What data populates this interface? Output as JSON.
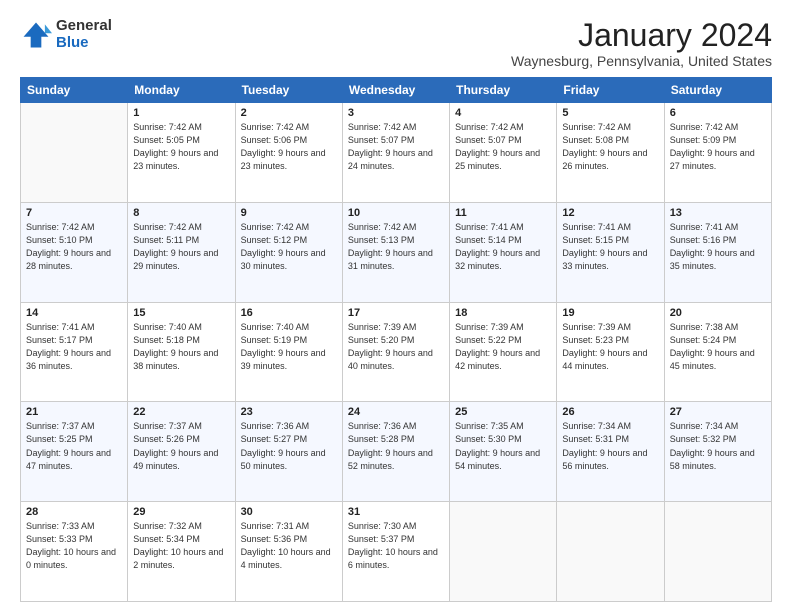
{
  "logo": {
    "general": "General",
    "blue": "Blue"
  },
  "title": "January 2024",
  "location": "Waynesburg, Pennsylvania, United States",
  "weekdays": [
    "Sunday",
    "Monday",
    "Tuesday",
    "Wednesday",
    "Thursday",
    "Friday",
    "Saturday"
  ],
  "weeks": [
    [
      {
        "day": "",
        "sunrise": "",
        "sunset": "",
        "daylight": ""
      },
      {
        "day": "1",
        "sunrise": "Sunrise: 7:42 AM",
        "sunset": "Sunset: 5:05 PM",
        "daylight": "Daylight: 9 hours and 23 minutes."
      },
      {
        "day": "2",
        "sunrise": "Sunrise: 7:42 AM",
        "sunset": "Sunset: 5:06 PM",
        "daylight": "Daylight: 9 hours and 23 minutes."
      },
      {
        "day": "3",
        "sunrise": "Sunrise: 7:42 AM",
        "sunset": "Sunset: 5:07 PM",
        "daylight": "Daylight: 9 hours and 24 minutes."
      },
      {
        "day": "4",
        "sunrise": "Sunrise: 7:42 AM",
        "sunset": "Sunset: 5:07 PM",
        "daylight": "Daylight: 9 hours and 25 minutes."
      },
      {
        "day": "5",
        "sunrise": "Sunrise: 7:42 AM",
        "sunset": "Sunset: 5:08 PM",
        "daylight": "Daylight: 9 hours and 26 minutes."
      },
      {
        "day": "6",
        "sunrise": "Sunrise: 7:42 AM",
        "sunset": "Sunset: 5:09 PM",
        "daylight": "Daylight: 9 hours and 27 minutes."
      }
    ],
    [
      {
        "day": "7",
        "sunrise": "Sunrise: 7:42 AM",
        "sunset": "Sunset: 5:10 PM",
        "daylight": "Daylight: 9 hours and 28 minutes."
      },
      {
        "day": "8",
        "sunrise": "Sunrise: 7:42 AM",
        "sunset": "Sunset: 5:11 PM",
        "daylight": "Daylight: 9 hours and 29 minutes."
      },
      {
        "day": "9",
        "sunrise": "Sunrise: 7:42 AM",
        "sunset": "Sunset: 5:12 PM",
        "daylight": "Daylight: 9 hours and 30 minutes."
      },
      {
        "day": "10",
        "sunrise": "Sunrise: 7:42 AM",
        "sunset": "Sunset: 5:13 PM",
        "daylight": "Daylight: 9 hours and 31 minutes."
      },
      {
        "day": "11",
        "sunrise": "Sunrise: 7:41 AM",
        "sunset": "Sunset: 5:14 PM",
        "daylight": "Daylight: 9 hours and 32 minutes."
      },
      {
        "day": "12",
        "sunrise": "Sunrise: 7:41 AM",
        "sunset": "Sunset: 5:15 PM",
        "daylight": "Daylight: 9 hours and 33 minutes."
      },
      {
        "day": "13",
        "sunrise": "Sunrise: 7:41 AM",
        "sunset": "Sunset: 5:16 PM",
        "daylight": "Daylight: 9 hours and 35 minutes."
      }
    ],
    [
      {
        "day": "14",
        "sunrise": "Sunrise: 7:41 AM",
        "sunset": "Sunset: 5:17 PM",
        "daylight": "Daylight: 9 hours and 36 minutes."
      },
      {
        "day": "15",
        "sunrise": "Sunrise: 7:40 AM",
        "sunset": "Sunset: 5:18 PM",
        "daylight": "Daylight: 9 hours and 38 minutes."
      },
      {
        "day": "16",
        "sunrise": "Sunrise: 7:40 AM",
        "sunset": "Sunset: 5:19 PM",
        "daylight": "Daylight: 9 hours and 39 minutes."
      },
      {
        "day": "17",
        "sunrise": "Sunrise: 7:39 AM",
        "sunset": "Sunset: 5:20 PM",
        "daylight": "Daylight: 9 hours and 40 minutes."
      },
      {
        "day": "18",
        "sunrise": "Sunrise: 7:39 AM",
        "sunset": "Sunset: 5:22 PM",
        "daylight": "Daylight: 9 hours and 42 minutes."
      },
      {
        "day": "19",
        "sunrise": "Sunrise: 7:39 AM",
        "sunset": "Sunset: 5:23 PM",
        "daylight": "Daylight: 9 hours and 44 minutes."
      },
      {
        "day": "20",
        "sunrise": "Sunrise: 7:38 AM",
        "sunset": "Sunset: 5:24 PM",
        "daylight": "Daylight: 9 hours and 45 minutes."
      }
    ],
    [
      {
        "day": "21",
        "sunrise": "Sunrise: 7:37 AM",
        "sunset": "Sunset: 5:25 PM",
        "daylight": "Daylight: 9 hours and 47 minutes."
      },
      {
        "day": "22",
        "sunrise": "Sunrise: 7:37 AM",
        "sunset": "Sunset: 5:26 PM",
        "daylight": "Daylight: 9 hours and 49 minutes."
      },
      {
        "day": "23",
        "sunrise": "Sunrise: 7:36 AM",
        "sunset": "Sunset: 5:27 PM",
        "daylight": "Daylight: 9 hours and 50 minutes."
      },
      {
        "day": "24",
        "sunrise": "Sunrise: 7:36 AM",
        "sunset": "Sunset: 5:28 PM",
        "daylight": "Daylight: 9 hours and 52 minutes."
      },
      {
        "day": "25",
        "sunrise": "Sunrise: 7:35 AM",
        "sunset": "Sunset: 5:30 PM",
        "daylight": "Daylight: 9 hours and 54 minutes."
      },
      {
        "day": "26",
        "sunrise": "Sunrise: 7:34 AM",
        "sunset": "Sunset: 5:31 PM",
        "daylight": "Daylight: 9 hours and 56 minutes."
      },
      {
        "day": "27",
        "sunrise": "Sunrise: 7:34 AM",
        "sunset": "Sunset: 5:32 PM",
        "daylight": "Daylight: 9 hours and 58 minutes."
      }
    ],
    [
      {
        "day": "28",
        "sunrise": "Sunrise: 7:33 AM",
        "sunset": "Sunset: 5:33 PM",
        "daylight": "Daylight: 10 hours and 0 minutes."
      },
      {
        "day": "29",
        "sunrise": "Sunrise: 7:32 AM",
        "sunset": "Sunset: 5:34 PM",
        "daylight": "Daylight: 10 hours and 2 minutes."
      },
      {
        "day": "30",
        "sunrise": "Sunrise: 7:31 AM",
        "sunset": "Sunset: 5:36 PM",
        "daylight": "Daylight: 10 hours and 4 minutes."
      },
      {
        "day": "31",
        "sunrise": "Sunrise: 7:30 AM",
        "sunset": "Sunset: 5:37 PM",
        "daylight": "Daylight: 10 hours and 6 minutes."
      },
      {
        "day": "",
        "sunrise": "",
        "sunset": "",
        "daylight": ""
      },
      {
        "day": "",
        "sunrise": "",
        "sunset": "",
        "daylight": ""
      },
      {
        "day": "",
        "sunrise": "",
        "sunset": "",
        "daylight": ""
      }
    ]
  ]
}
